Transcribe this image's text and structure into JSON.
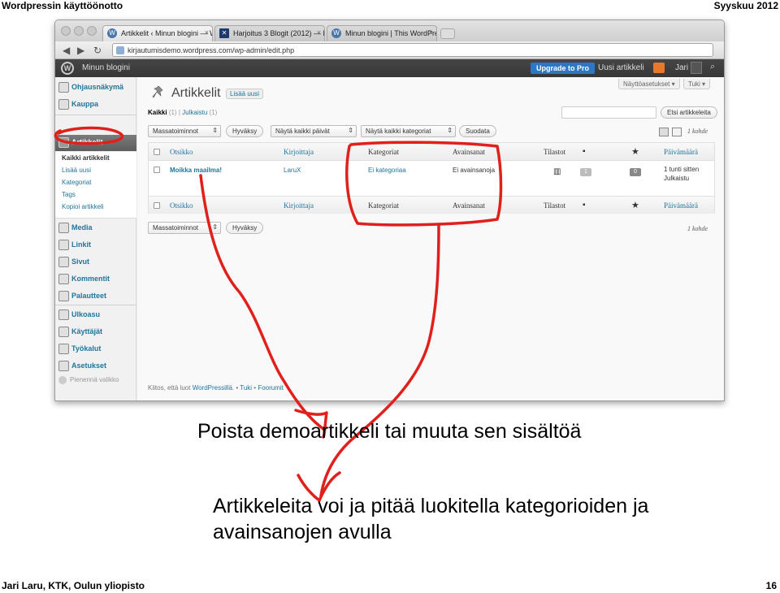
{
  "slide": {
    "header_left": "Wordpressin käyttöönotto",
    "header_right": "Syyskuu 2012",
    "footer_left": "Jari Laru, KTK, Oulun yliopisto",
    "page_number": "16"
  },
  "browser": {
    "tabs": [
      {
        "label": "Artikkelit ‹ Minun blogini — W",
        "icon": "wordpress-icon"
      },
      {
        "label": "Harjoitus 3 Blogit (2012) — K",
        "icon": "harjoitus-icon"
      },
      {
        "label": "Minun blogini | This WordPre",
        "icon": "wordpress-icon"
      }
    ],
    "url": "kirjautumisdemo.wordpress.com/wp-admin/edit.php"
  },
  "adminbar": {
    "site_name": "Minun blogini",
    "upgrade": "Upgrade to Pro",
    "new_post": "Uusi artikkeli",
    "user": "Jari"
  },
  "sidebar": {
    "items": [
      {
        "label": "Ohjausnäkymä",
        "icon": "dashboard-icon"
      },
      {
        "label": "Kauppa",
        "icon": "store-icon"
      },
      {
        "label": "Artikkelit",
        "icon": "pin-icon"
      },
      {
        "label": "Media",
        "icon": "media-icon"
      },
      {
        "label": "Linkit",
        "icon": "links-icon"
      },
      {
        "label": "Sivut",
        "icon": "pages-icon"
      },
      {
        "label": "Kommentit",
        "icon": "comments-icon"
      },
      {
        "label": "Palautteet",
        "icon": "feedback-icon"
      },
      {
        "label": "Ulkoasu",
        "icon": "appearance-icon"
      },
      {
        "label": "Käyttäjät",
        "icon": "users-icon"
      },
      {
        "label": "Työkalut",
        "icon": "tools-icon"
      },
      {
        "label": "Asetukset",
        "icon": "settings-icon"
      }
    ],
    "submenu": [
      "Kaikki artikkelit",
      "Lisää uusi",
      "Kategoriat",
      "Tags",
      "Kopioi artikkeli"
    ],
    "collapse": "Pienennä valikko"
  },
  "main": {
    "screen_options": "Näyttöasetukset",
    "help": "Tuki",
    "title": "Artikkelit",
    "add_new": "Lisää uusi",
    "filter_all": "Kaikki",
    "filter_all_count": "(1)",
    "filter_sep": "|",
    "filter_published": "Julkaistu",
    "filter_published_count": "(1)",
    "search_button": "Etsi artikkeleita",
    "bulk_actions": "Massatoiminnot",
    "apply": "Hyväksy",
    "all_dates": "Näytä kaikki päivät",
    "all_categories": "Näytä kaikki kategoriat",
    "filter_button": "Suodata",
    "item_count": "1 kohde",
    "columns": {
      "title": "Otsikko",
      "author": "Kirjoittaja",
      "categories": "Kategoriat",
      "tags": "Avainsanat",
      "stats": "Tilastot",
      "date": "Päivämäärä"
    },
    "row": {
      "title": "Moikka maailma!",
      "author": "LaruX",
      "categories": "Ei kategoriaa",
      "tags": "Ei avainsanoja",
      "comments": "1",
      "likes": "0",
      "date": "1 tunti sitten",
      "status": "Julkaistu"
    },
    "footer_prefix": "Kiitos, että luot ",
    "footer_link": "WordPressillä",
    "footer_mid": ". • ",
    "footer_support": "Tuki",
    "footer_sep": " • ",
    "footer_forums": "Foorumit"
  },
  "captions": {
    "line1": "Poista demoartikkeli tai muuta sen sisältöä",
    "line2": "Artikkeleita voi ja pitää luokitella kategorioiden ja avainsanojen avulla"
  },
  "colors": {
    "annotation": "#e0211b",
    "wp_link": "#21759b",
    "adminbar": "#3e3e3e"
  }
}
